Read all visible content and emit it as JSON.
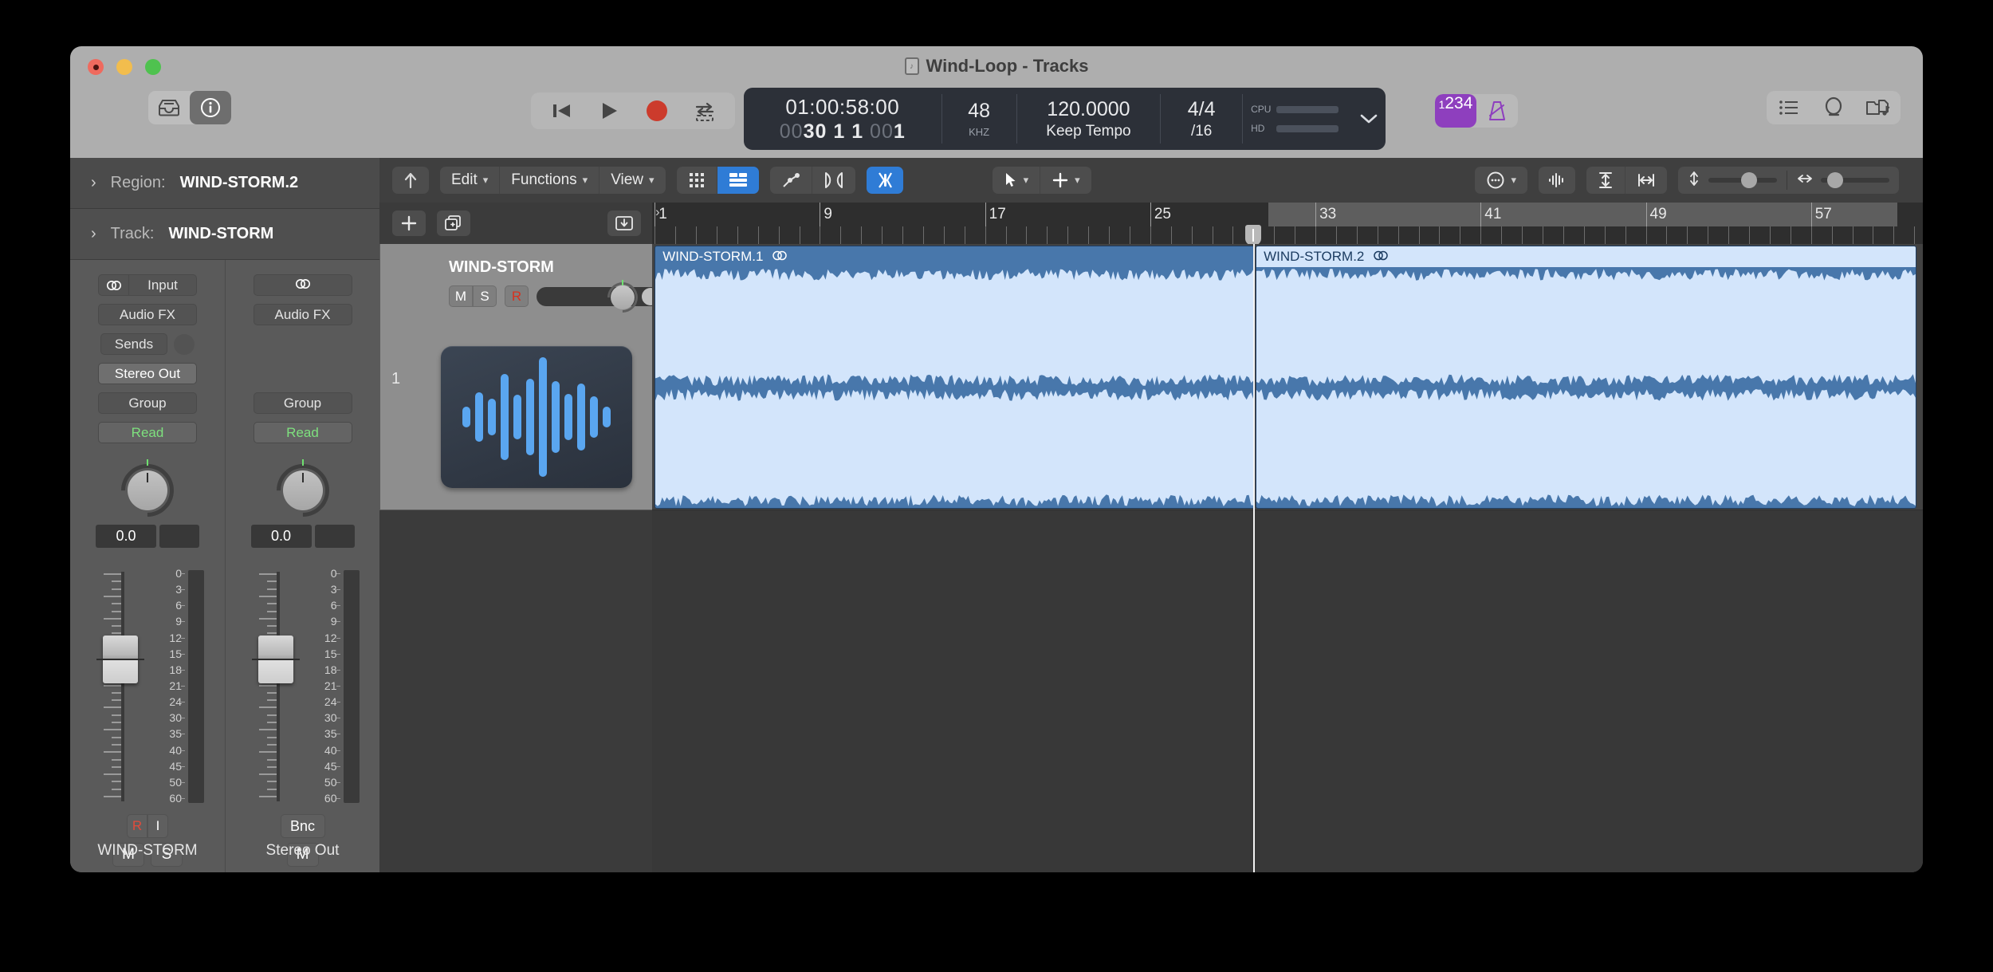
{
  "window": {
    "title": "Wind-Loop - Tracks",
    "doc_icon": "audio-document-icon",
    "traffic": {
      "close": "close",
      "minimize": "minimize",
      "zoom": "zoom"
    }
  },
  "control_bar": {
    "left_buttons": [
      {
        "name": "library-icon",
        "active": false
      },
      {
        "name": "info-icon",
        "active": true
      }
    ],
    "transport": [
      {
        "name": "go-to-beginning-icon",
        "label": "Go to Beginning"
      },
      {
        "name": "play-icon",
        "label": "Play"
      },
      {
        "name": "record-icon",
        "label": "Record"
      },
      {
        "name": "cycle-icon",
        "label": "Cycle"
      }
    ],
    "lcd": {
      "timecode": "01:00:58:00",
      "bars_dim_1": "00",
      "bars_1": "30",
      "bars_2": "1",
      "bars_3": "1",
      "bars_dim_2": "00",
      "bars_4": "1",
      "sample_rate": "48",
      "sample_rate_unit": "KHZ",
      "tempo": "120.0000",
      "tempo_mode": "Keep Tempo",
      "time_signature": "4/4",
      "division": "/16",
      "cpu_label": "CPU",
      "hd_label": "HD",
      "chevron": "chevron-down-icon"
    },
    "count_in": {
      "small": "1",
      "big": "234",
      "active": true
    },
    "metronome": {
      "name": "metronome-icon",
      "active": false
    },
    "right_buttons": [
      {
        "name": "list-editors-icon"
      },
      {
        "name": "loops-browser-icon"
      },
      {
        "name": "media-browser-icon"
      }
    ]
  },
  "inspector": {
    "region_row": {
      "chevron": "›",
      "label": "Region:",
      "value": "WIND-STORM.2"
    },
    "track_row": {
      "chevron": "›",
      "label": "Track:",
      "value": "WIND-STORM"
    },
    "channel_strips": [
      {
        "input_icon": "stereo-icon",
        "input_label": "Input",
        "audio_fx": "Audio FX",
        "sends": "Sends",
        "output": "Stereo Out",
        "group": "Group",
        "automation": "Read",
        "gain_value": "0.0",
        "rec_enable": "R",
        "input_monitor": "I",
        "mute": "M",
        "solo": "S",
        "name": "WIND-STORM"
      },
      {
        "input_icon": "stereo-icon",
        "input_label": "",
        "audio_fx": "Audio FX",
        "sends": "",
        "output": "",
        "group": "Group",
        "automation": "Read",
        "gain_value": "0.0",
        "bounce": "Bnc",
        "mute": "M",
        "name": "Stereo Out"
      }
    ],
    "db_scale": [
      "0",
      "3",
      "6",
      "9",
      "12",
      "15",
      "18",
      "21",
      "24",
      "30",
      "35",
      "40",
      "45",
      "50",
      "60"
    ]
  },
  "arrange_menubar": {
    "back_icon": "catch-playhead-icon",
    "menus": [
      {
        "label": "Edit",
        "chevron": "chevron-down-icon"
      },
      {
        "label": "Functions",
        "chevron": "chevron-down-icon"
      },
      {
        "label": "View",
        "chevron": "chevron-down-icon"
      }
    ],
    "view_toggles": [
      {
        "name": "grid-view-icon",
        "selected": false
      },
      {
        "name": "list-view-icon",
        "selected": true
      }
    ],
    "edit_toggles": [
      {
        "name": "automation-icon",
        "selected": false
      },
      {
        "name": "flex-icon",
        "selected": false
      }
    ],
    "snap_tool": {
      "name": "fade-tool-icon",
      "selected": true
    },
    "tools": [
      {
        "name": "pointer-tool-icon",
        "chevron": "chevron-down-icon"
      },
      {
        "name": "marquee-tool-icon",
        "chevron": "chevron-down-icon"
      }
    ],
    "right_tools": [
      {
        "name": "more-options-icon",
        "chevron": "chevron-down-icon"
      },
      {
        "name": "waveform-zoom-icon"
      },
      {
        "name": "fit-vertical-icon"
      },
      {
        "name": "fit-horizontal-icon"
      }
    ],
    "zoom_vertical": {
      "icon": "zoom-vertical-icon",
      "position_pct": 62
    },
    "zoom_horizontal": {
      "icon": "zoom-horizontal-icon",
      "position_pct": 12
    }
  },
  "track_area": {
    "toolbar": [
      {
        "name": "add-track-icon",
        "label": "+"
      },
      {
        "name": "duplicate-track-icon"
      },
      {
        "name": "import-icon"
      }
    ],
    "track": {
      "number": "1",
      "name": "WIND-STORM",
      "mute": "M",
      "solo": "S",
      "record": "R",
      "volume_pct": 86,
      "pan_icon": "pan-knob",
      "artwork": {
        "name": "audio-track-artwork",
        "bars": [
          26,
          62,
          46,
          108,
          56,
          96,
          150,
          90,
          58,
          84,
          52,
          26
        ]
      }
    }
  },
  "ruler": {
    "bar_labels": [
      "1",
      "9",
      "17",
      "25",
      "33",
      "41",
      "49",
      "57"
    ],
    "bar_positions_pct": [
      0.2,
      13.2,
      26.2,
      39.2,
      52.2,
      65.2,
      78.2,
      91.2
    ],
    "lit_from_pct": 48.5,
    "playhead_pct": 47.3,
    "left_marker": "›"
  },
  "regions": [
    {
      "name": "WIND-STORM.1",
      "stereo_icon": "stereo-icon",
      "selected": false,
      "left_pct": 0.2,
      "width_pct": 47.2
    },
    {
      "name": "WIND-STORM.2",
      "stereo_icon": "stereo-icon",
      "selected": true,
      "left_pct": 47.5,
      "width_pct": 52.0
    }
  ],
  "colors": {
    "accent_blue": "#2f7cd6",
    "region_blue": "#4877ab",
    "region_wave": "#d3e5fb",
    "purple": "#8e3fbe",
    "record_red": "#cc3b2c",
    "automation_green": "#7ee07e"
  }
}
